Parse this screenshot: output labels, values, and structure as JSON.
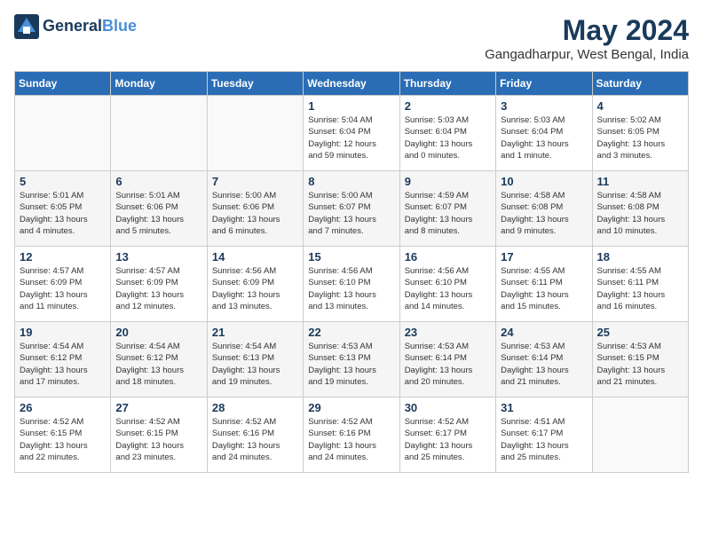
{
  "header": {
    "logo_line1": "General",
    "logo_line2": "Blue",
    "month": "May 2024",
    "location": "Gangadharpur, West Bengal, India"
  },
  "weekdays": [
    "Sunday",
    "Monday",
    "Tuesday",
    "Wednesday",
    "Thursday",
    "Friday",
    "Saturday"
  ],
  "weeks": [
    [
      {
        "day": "",
        "info": ""
      },
      {
        "day": "",
        "info": ""
      },
      {
        "day": "",
        "info": ""
      },
      {
        "day": "1",
        "info": "Sunrise: 5:04 AM\nSunset: 6:04 PM\nDaylight: 12 hours\nand 59 minutes."
      },
      {
        "day": "2",
        "info": "Sunrise: 5:03 AM\nSunset: 6:04 PM\nDaylight: 13 hours\nand 0 minutes."
      },
      {
        "day": "3",
        "info": "Sunrise: 5:03 AM\nSunset: 6:04 PM\nDaylight: 13 hours\nand 1 minute."
      },
      {
        "day": "4",
        "info": "Sunrise: 5:02 AM\nSunset: 6:05 PM\nDaylight: 13 hours\nand 3 minutes."
      }
    ],
    [
      {
        "day": "5",
        "info": "Sunrise: 5:01 AM\nSunset: 6:05 PM\nDaylight: 13 hours\nand 4 minutes."
      },
      {
        "day": "6",
        "info": "Sunrise: 5:01 AM\nSunset: 6:06 PM\nDaylight: 13 hours\nand 5 minutes."
      },
      {
        "day": "7",
        "info": "Sunrise: 5:00 AM\nSunset: 6:06 PM\nDaylight: 13 hours\nand 6 minutes."
      },
      {
        "day": "8",
        "info": "Sunrise: 5:00 AM\nSunset: 6:07 PM\nDaylight: 13 hours\nand 7 minutes."
      },
      {
        "day": "9",
        "info": "Sunrise: 4:59 AM\nSunset: 6:07 PM\nDaylight: 13 hours\nand 8 minutes."
      },
      {
        "day": "10",
        "info": "Sunrise: 4:58 AM\nSunset: 6:08 PM\nDaylight: 13 hours\nand 9 minutes."
      },
      {
        "day": "11",
        "info": "Sunrise: 4:58 AM\nSunset: 6:08 PM\nDaylight: 13 hours\nand 10 minutes."
      }
    ],
    [
      {
        "day": "12",
        "info": "Sunrise: 4:57 AM\nSunset: 6:09 PM\nDaylight: 13 hours\nand 11 minutes."
      },
      {
        "day": "13",
        "info": "Sunrise: 4:57 AM\nSunset: 6:09 PM\nDaylight: 13 hours\nand 12 minutes."
      },
      {
        "day": "14",
        "info": "Sunrise: 4:56 AM\nSunset: 6:09 PM\nDaylight: 13 hours\nand 13 minutes."
      },
      {
        "day": "15",
        "info": "Sunrise: 4:56 AM\nSunset: 6:10 PM\nDaylight: 13 hours\nand 13 minutes."
      },
      {
        "day": "16",
        "info": "Sunrise: 4:56 AM\nSunset: 6:10 PM\nDaylight: 13 hours\nand 14 minutes."
      },
      {
        "day": "17",
        "info": "Sunrise: 4:55 AM\nSunset: 6:11 PM\nDaylight: 13 hours\nand 15 minutes."
      },
      {
        "day": "18",
        "info": "Sunrise: 4:55 AM\nSunset: 6:11 PM\nDaylight: 13 hours\nand 16 minutes."
      }
    ],
    [
      {
        "day": "19",
        "info": "Sunrise: 4:54 AM\nSunset: 6:12 PM\nDaylight: 13 hours\nand 17 minutes."
      },
      {
        "day": "20",
        "info": "Sunrise: 4:54 AM\nSunset: 6:12 PM\nDaylight: 13 hours\nand 18 minutes."
      },
      {
        "day": "21",
        "info": "Sunrise: 4:54 AM\nSunset: 6:13 PM\nDaylight: 13 hours\nand 19 minutes."
      },
      {
        "day": "22",
        "info": "Sunrise: 4:53 AM\nSunset: 6:13 PM\nDaylight: 13 hours\nand 19 minutes."
      },
      {
        "day": "23",
        "info": "Sunrise: 4:53 AM\nSunset: 6:14 PM\nDaylight: 13 hours\nand 20 minutes."
      },
      {
        "day": "24",
        "info": "Sunrise: 4:53 AM\nSunset: 6:14 PM\nDaylight: 13 hours\nand 21 minutes."
      },
      {
        "day": "25",
        "info": "Sunrise: 4:53 AM\nSunset: 6:15 PM\nDaylight: 13 hours\nand 21 minutes."
      }
    ],
    [
      {
        "day": "26",
        "info": "Sunrise: 4:52 AM\nSunset: 6:15 PM\nDaylight: 13 hours\nand 22 minutes."
      },
      {
        "day": "27",
        "info": "Sunrise: 4:52 AM\nSunset: 6:15 PM\nDaylight: 13 hours\nand 23 minutes."
      },
      {
        "day": "28",
        "info": "Sunrise: 4:52 AM\nSunset: 6:16 PM\nDaylight: 13 hours\nand 24 minutes."
      },
      {
        "day": "29",
        "info": "Sunrise: 4:52 AM\nSunset: 6:16 PM\nDaylight: 13 hours\nand 24 minutes."
      },
      {
        "day": "30",
        "info": "Sunrise: 4:52 AM\nSunset: 6:17 PM\nDaylight: 13 hours\nand 25 minutes."
      },
      {
        "day": "31",
        "info": "Sunrise: 4:51 AM\nSunset: 6:17 PM\nDaylight: 13 hours\nand 25 minutes."
      },
      {
        "day": "",
        "info": ""
      }
    ]
  ]
}
